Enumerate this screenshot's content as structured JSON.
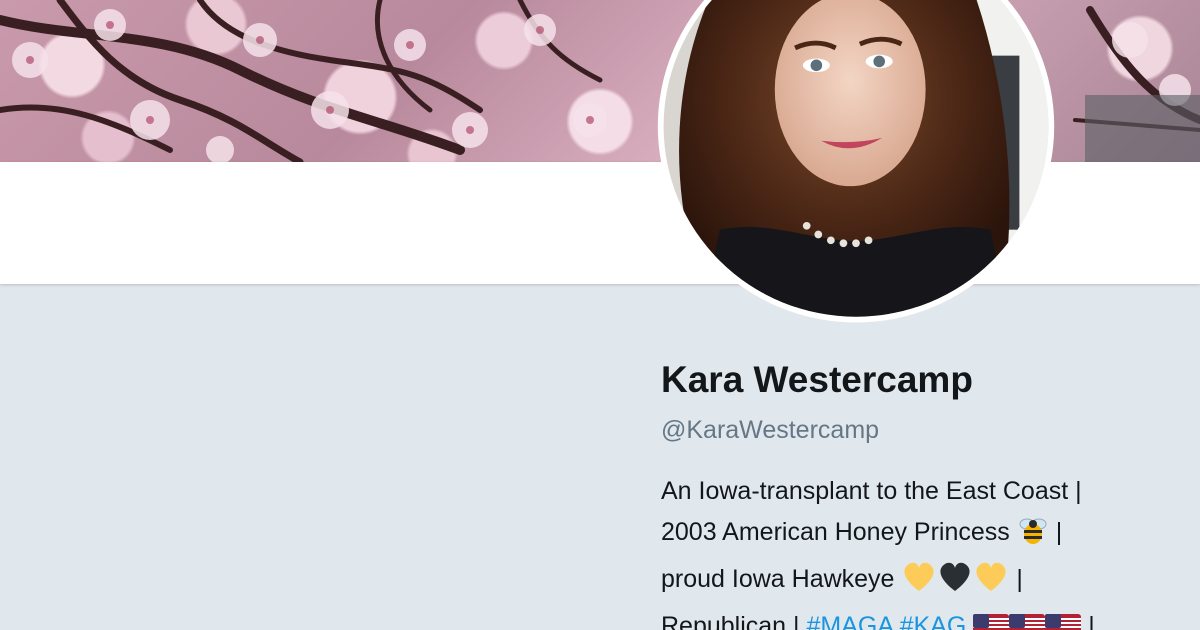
{
  "banner": {
    "image_description": "cherry-blossom-photo"
  },
  "avatar": {
    "image_description": "profile-photo"
  },
  "profile": {
    "display_name": "Kara Westercamp",
    "handle": "@KaraWestercamp",
    "bio": {
      "line1": "An Iowa-transplant to the East Coast |",
      "line2_text": "2003 American Honey Princess",
      "line2_sep": "|",
      "line3_text": "proud Iowa Hawkeye",
      "line3_sep": "|",
      "line4_text": "Republican |",
      "hashtag1": "#MAGA",
      "hashtag2": "#KAG",
      "line4_sep": "|"
    },
    "emoji": {
      "bee": "bee-icon",
      "hearts": [
        "yellow-heart-icon",
        "black-heart-icon",
        "yellow-heart-icon"
      ],
      "flags": [
        "us-flag-icon",
        "us-flag-icon",
        "us-flag-icon"
      ]
    }
  },
  "colors": {
    "page_background": "#e1e8ed",
    "name_text": "#14171a",
    "handle_text": "#657786",
    "hashtag": "#1b95e0",
    "nav_background": "#ffffff"
  }
}
